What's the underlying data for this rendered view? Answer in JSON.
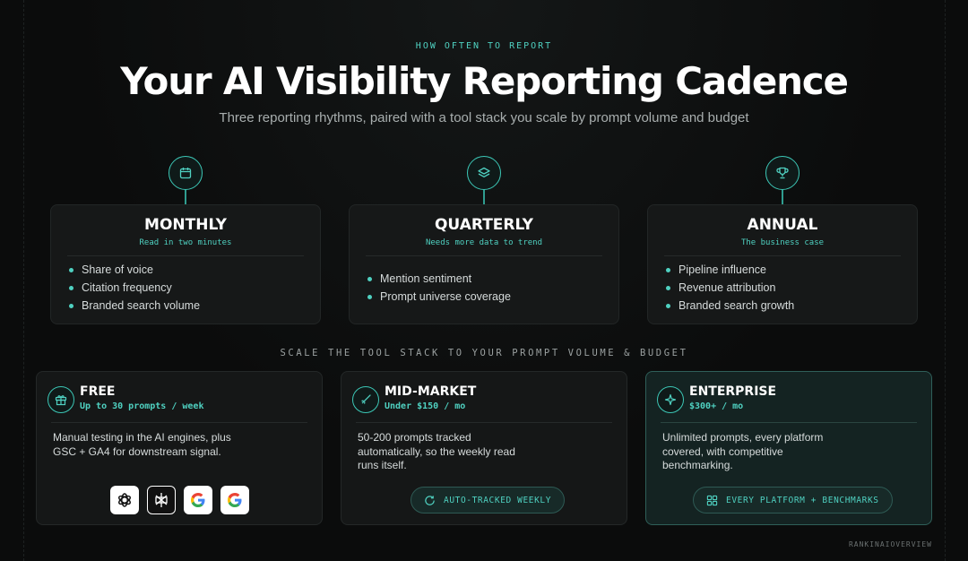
{
  "header": {
    "eyebrow": "HOW OFTEN TO REPORT",
    "title": "Your AI Visibility Reporting Cadence",
    "subtitle": "Three reporting rhythms, paired with a tool stack you scale by prompt volume and budget"
  },
  "cadences": [
    {
      "icon": "calendar-icon",
      "name": "MONTHLY",
      "subtitle": "Read in two minutes",
      "items": [
        "Share of voice",
        "Citation frequency",
        "Branded search volume"
      ]
    },
    {
      "icon": "layers-icon",
      "name": "QUARTERLY",
      "subtitle": "Needs more data to trend",
      "items": [
        "Mention sentiment",
        "Prompt universe coverage"
      ]
    },
    {
      "icon": "trophy-icon",
      "name": "ANNUAL",
      "subtitle": "The business case",
      "items": [
        "Pipeline influence",
        "Revenue attribution",
        "Branded search growth"
      ]
    }
  ],
  "tool_section_label": "SCALE THE TOOL STACK TO YOUR PROMPT VOLUME & BUDGET",
  "tiers": [
    {
      "icon": "gift-icon",
      "name": "FREE",
      "price": "Up to 30 prompts / week",
      "description": "Manual testing in the AI engines, plus GSC + GA4 for downstream signal.",
      "logos": [
        "chatgpt-logo",
        "perplexity-logo",
        "google-logo",
        "google-logo"
      ]
    },
    {
      "icon": "rocket-icon",
      "name": "MID-MARKET",
      "price": "Under $150 / mo",
      "description": "50-200 prompts tracked automatically, so the weekly read runs itself.",
      "pill": {
        "icon": "refresh-icon",
        "label": "AUTO-TRACKED WEEKLY"
      }
    },
    {
      "icon": "sparkle-icon",
      "name": "ENTERPRISE",
      "price": "$300+ / mo",
      "description": "Unlimited prompts, every platform covered, with competitive benchmarking.",
      "pill": {
        "icon": "grid-icon",
        "label": "EVERY PLATFORM + BENCHMARKS"
      }
    }
  ],
  "brand": "RANKINAIOVERVIEW",
  "colors": {
    "accent": "#4fd1c1",
    "background": "#0b0c0c",
    "card": "#161818",
    "enterprise_card": "#142322"
  }
}
